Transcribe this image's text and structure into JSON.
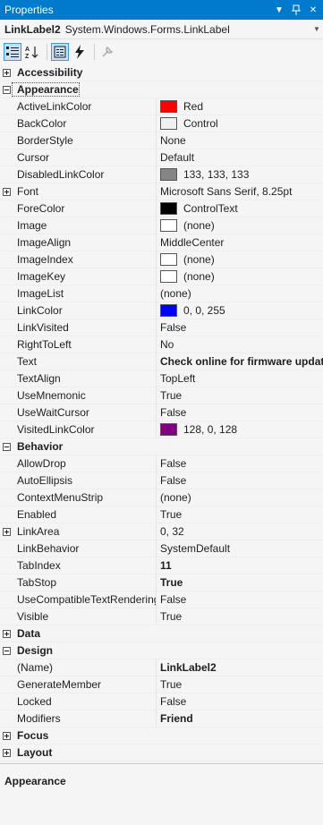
{
  "window": {
    "title": "Properties"
  },
  "selector": {
    "object_name": "LinkLabel2",
    "object_type": "System.Windows.Forms.LinkLabel"
  },
  "toolbar": {
    "buttons": [
      "categorized-icon",
      "alphabetical-icon",
      "properties-icon",
      "events-icon",
      "property-pages-icon"
    ]
  },
  "grid": {
    "accessibility": {
      "label": "Accessibility"
    },
    "appearance": {
      "label": "Appearance",
      "props": [
        {
          "name": "ActiveLinkColor",
          "value": "Red",
          "swatch": "#ff0000"
        },
        {
          "name": "BackColor",
          "value": "Control",
          "swatch": "#f0f0f0"
        },
        {
          "name": "BorderStyle",
          "value": "None"
        },
        {
          "name": "Cursor",
          "value": "Default"
        },
        {
          "name": "DisabledLinkColor",
          "value": "133, 133, 133",
          "swatch": "#858585"
        },
        {
          "name": "Font",
          "value": "Microsoft Sans Serif, 8.25pt"
        },
        {
          "name": "ForeColor",
          "value": "ControlText",
          "swatch": "#000000"
        },
        {
          "name": "Image",
          "value": "(none)",
          "swatch": "#ffffff"
        },
        {
          "name": "ImageAlign",
          "value": "MiddleCenter"
        },
        {
          "name": "ImageIndex",
          "value": "(none)",
          "swatch": "#ffffff"
        },
        {
          "name": "ImageKey",
          "value": "(none)",
          "swatch": "#ffffff"
        },
        {
          "name": "ImageList",
          "value": "(none)"
        },
        {
          "name": "LinkColor",
          "value": "0, 0, 255",
          "swatch": "#0000ff"
        },
        {
          "name": "LinkVisited",
          "value": "False"
        },
        {
          "name": "RightToLeft",
          "value": "No"
        },
        {
          "name": "Text",
          "value": "Check online for firmware updat"
        },
        {
          "name": "TextAlign",
          "value": "TopLeft"
        },
        {
          "name": "UseMnemonic",
          "value": "True"
        },
        {
          "name": "UseWaitCursor",
          "value": "False"
        },
        {
          "name": "VisitedLinkColor",
          "value": "128, 0, 128",
          "swatch": "#800080"
        }
      ]
    },
    "behavior": {
      "label": "Behavior",
      "props": [
        {
          "name": "AllowDrop",
          "value": "False"
        },
        {
          "name": "AutoEllipsis",
          "value": "False"
        },
        {
          "name": "ContextMenuStrip",
          "value": "(none)"
        },
        {
          "name": "Enabled",
          "value": "True"
        },
        {
          "name": "LinkArea",
          "value": "0, 32"
        },
        {
          "name": "LinkBehavior",
          "value": "SystemDefault"
        },
        {
          "name": "TabIndex",
          "value": "11"
        },
        {
          "name": "TabStop",
          "value": "True"
        },
        {
          "name": "UseCompatibleTextRendering",
          "value": "False"
        },
        {
          "name": "Visible",
          "value": "True"
        }
      ]
    },
    "data": {
      "label": "Data"
    },
    "design": {
      "label": "Design",
      "props": [
        {
          "name": "(Name)",
          "value": "LinkLabel2"
        },
        {
          "name": "GenerateMember",
          "value": "True"
        },
        {
          "name": "Locked",
          "value": "False"
        },
        {
          "name": "Modifiers",
          "value": "Friend"
        }
      ]
    },
    "focus": {
      "label": "Focus"
    },
    "layout": {
      "label": "Layout"
    }
  },
  "description": {
    "title": "Appearance"
  }
}
